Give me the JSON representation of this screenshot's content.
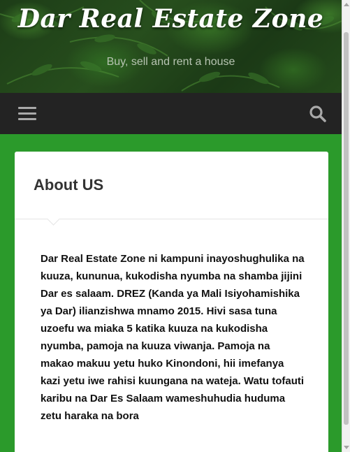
{
  "header": {
    "site_title": "Dar Real Estate Zone",
    "tagline": "Buy, sell and rent a house"
  },
  "navbar": {
    "menu_icon": "hamburger-menu-icon",
    "search_icon": "search-icon"
  },
  "page": {
    "title": "About US",
    "body": "Dar Real Estate Zone ni kampuni inayoshughulika na kuuza, kununua, kukodisha nyumba na shamba jijini Dar es salaam. DREZ (Kanda ya Mali Isiyohamishika ya Dar) ilianzishwa mnamo 2015. Hivi sasa tuna uzoefu wa miaka 5 katika kuuza na kukodisha nyumba, pamoja na kuuza viwanja. Pamoja na makao makuu yetu huko Kinondoni, hii imefanya kazi yetu iwe rahisi kuungana na wateja.   Watu tofauti karibu na Dar Es Salaam wameshuhudia huduma zetu haraka na bora"
  },
  "colors": {
    "background": "#2b9a2b",
    "navbar": "#232323",
    "card": "#ffffff",
    "title_text": "#ffffff",
    "tagline_text": "#b7c4b2"
  }
}
